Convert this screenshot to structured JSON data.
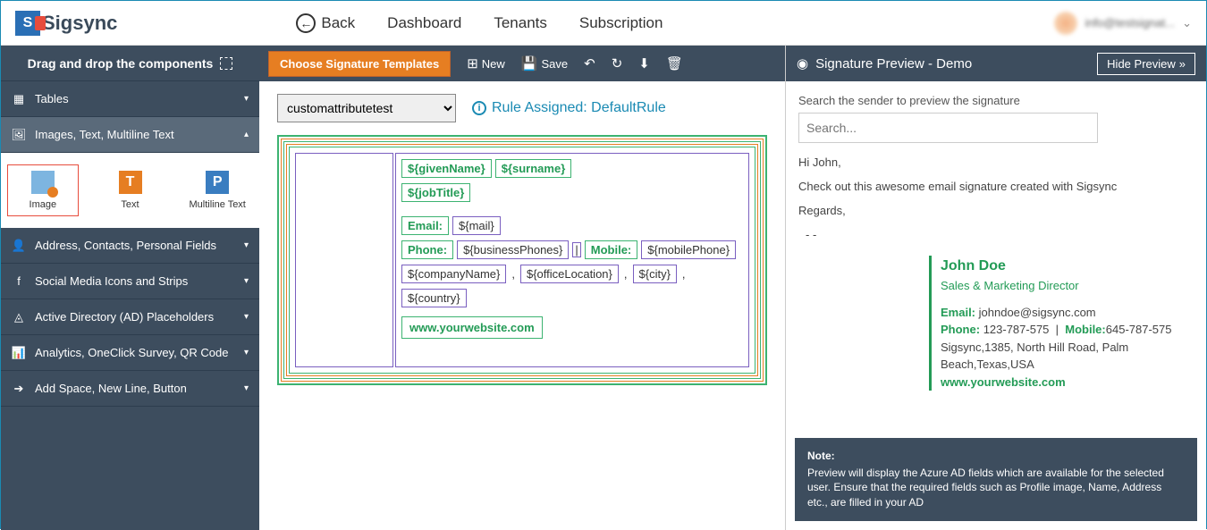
{
  "header": {
    "logo_text": "Sigsync",
    "nav": {
      "back": "Back",
      "dashboard": "Dashboard",
      "tenants": "Tenants",
      "subscription": "Subscription"
    },
    "user": "info@testsignat..."
  },
  "sidebar": {
    "title": "Drag and drop the components",
    "items": [
      {
        "label": "Tables"
      },
      {
        "label": "Images, Text, Multiline Text"
      },
      {
        "label": "Address, Contacts, Personal Fields"
      },
      {
        "label": "Social Media Icons and Strips"
      },
      {
        "label": "Active Directory (AD) Placeholders"
      },
      {
        "label": "Analytics, OneClick Survey, QR Code"
      },
      {
        "label": "Add Space, New Line, Button"
      }
    ],
    "components": {
      "image": "Image",
      "text": "Text",
      "multiline": "Multiline Text"
    }
  },
  "toolbar": {
    "templates": "Choose Signature Templates",
    "new": "New",
    "save": "Save"
  },
  "rule": {
    "selected": "customattributetest",
    "assigned": "Rule Assigned: DefaultRule"
  },
  "editor": {
    "givenName": "${givenName}",
    "surname": "${surname}",
    "jobTitle": "${jobTitle}",
    "email_lbl": "Email:",
    "mail": "${mail}",
    "phone_lbl": "Phone:",
    "businessPhones": "${businessPhones}",
    "mobile_lbl": "Mobile:",
    "mobilePhone": "${mobilePhone}",
    "companyName": "${companyName}",
    "officeLocation": "${officeLocation}",
    "city": "${city}",
    "country": "${country}",
    "website": "www.yourwebsite.com"
  },
  "preview": {
    "title": "Signature Preview - Demo",
    "hide": "Hide Preview",
    "search_label": "Search the sender to preview the signature",
    "search_placeholder": "Search...",
    "greeting": "Hi John,",
    "body": "Check out this awesome email signature created with Sigsync",
    "regards": "Regards,",
    "dash": "- -",
    "sig": {
      "name": "John Doe",
      "title": "Sales & Marketing Director",
      "email_lbl": "Email:",
      "email": "johndoe@sigsync.com",
      "phone_lbl": "Phone:",
      "phone": "123-787-575",
      "mobile_lbl": "Mobile:",
      "mobile": "645-787-575",
      "address": "Sigsync,1385, North Hill Road, Palm Beach,Texas,USA",
      "website": "www.yourwebsite.com"
    },
    "note_title": "Note:",
    "note_body": "Preview will display the Azure AD fields which are available for the selected user. Ensure that the required fields such as Profile image, Name, Address etc., are filled in your AD"
  }
}
